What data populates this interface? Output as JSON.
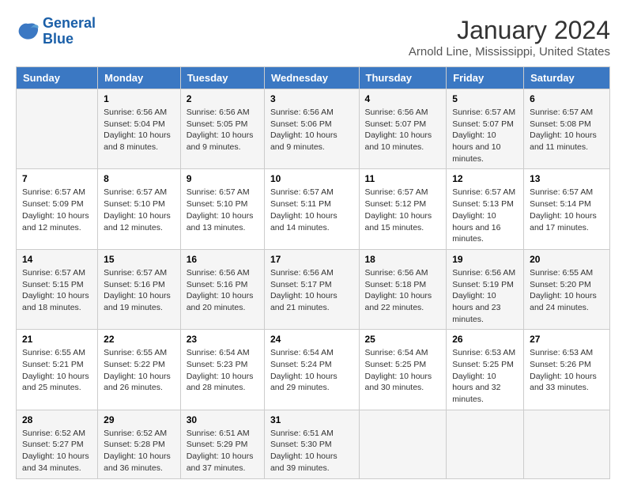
{
  "logo": {
    "line1": "General",
    "line2": "Blue"
  },
  "title": "January 2024",
  "location": "Arnold Line, Mississippi, United States",
  "header_days": [
    "Sunday",
    "Monday",
    "Tuesday",
    "Wednesday",
    "Thursday",
    "Friday",
    "Saturday"
  ],
  "weeks": [
    [
      {
        "day": "",
        "sunrise": "",
        "sunset": "",
        "daylight": ""
      },
      {
        "day": "1",
        "sunrise": "Sunrise: 6:56 AM",
        "sunset": "Sunset: 5:04 PM",
        "daylight": "Daylight: 10 hours and 8 minutes."
      },
      {
        "day": "2",
        "sunrise": "Sunrise: 6:56 AM",
        "sunset": "Sunset: 5:05 PM",
        "daylight": "Daylight: 10 hours and 9 minutes."
      },
      {
        "day": "3",
        "sunrise": "Sunrise: 6:56 AM",
        "sunset": "Sunset: 5:06 PM",
        "daylight": "Daylight: 10 hours and 9 minutes."
      },
      {
        "day": "4",
        "sunrise": "Sunrise: 6:56 AM",
        "sunset": "Sunset: 5:07 PM",
        "daylight": "Daylight: 10 hours and 10 minutes."
      },
      {
        "day": "5",
        "sunrise": "Sunrise: 6:57 AM",
        "sunset": "Sunset: 5:07 PM",
        "daylight": "Daylight: 10 hours and 10 minutes."
      },
      {
        "day": "6",
        "sunrise": "Sunrise: 6:57 AM",
        "sunset": "Sunset: 5:08 PM",
        "daylight": "Daylight: 10 hours and 11 minutes."
      }
    ],
    [
      {
        "day": "7",
        "sunrise": "Sunrise: 6:57 AM",
        "sunset": "Sunset: 5:09 PM",
        "daylight": "Daylight: 10 hours and 12 minutes."
      },
      {
        "day": "8",
        "sunrise": "Sunrise: 6:57 AM",
        "sunset": "Sunset: 5:10 PM",
        "daylight": "Daylight: 10 hours and 12 minutes."
      },
      {
        "day": "9",
        "sunrise": "Sunrise: 6:57 AM",
        "sunset": "Sunset: 5:10 PM",
        "daylight": "Daylight: 10 hours and 13 minutes."
      },
      {
        "day": "10",
        "sunrise": "Sunrise: 6:57 AM",
        "sunset": "Sunset: 5:11 PM",
        "daylight": "Daylight: 10 hours and 14 minutes."
      },
      {
        "day": "11",
        "sunrise": "Sunrise: 6:57 AM",
        "sunset": "Sunset: 5:12 PM",
        "daylight": "Daylight: 10 hours and 15 minutes."
      },
      {
        "day": "12",
        "sunrise": "Sunrise: 6:57 AM",
        "sunset": "Sunset: 5:13 PM",
        "daylight": "Daylight: 10 hours and 16 minutes."
      },
      {
        "day": "13",
        "sunrise": "Sunrise: 6:57 AM",
        "sunset": "Sunset: 5:14 PM",
        "daylight": "Daylight: 10 hours and 17 minutes."
      }
    ],
    [
      {
        "day": "14",
        "sunrise": "Sunrise: 6:57 AM",
        "sunset": "Sunset: 5:15 PM",
        "daylight": "Daylight: 10 hours and 18 minutes."
      },
      {
        "day": "15",
        "sunrise": "Sunrise: 6:57 AM",
        "sunset": "Sunset: 5:16 PM",
        "daylight": "Daylight: 10 hours and 19 minutes."
      },
      {
        "day": "16",
        "sunrise": "Sunrise: 6:56 AM",
        "sunset": "Sunset: 5:16 PM",
        "daylight": "Daylight: 10 hours and 20 minutes."
      },
      {
        "day": "17",
        "sunrise": "Sunrise: 6:56 AM",
        "sunset": "Sunset: 5:17 PM",
        "daylight": "Daylight: 10 hours and 21 minutes."
      },
      {
        "day": "18",
        "sunrise": "Sunrise: 6:56 AM",
        "sunset": "Sunset: 5:18 PM",
        "daylight": "Daylight: 10 hours and 22 minutes."
      },
      {
        "day": "19",
        "sunrise": "Sunrise: 6:56 AM",
        "sunset": "Sunset: 5:19 PM",
        "daylight": "Daylight: 10 hours and 23 minutes."
      },
      {
        "day": "20",
        "sunrise": "Sunrise: 6:55 AM",
        "sunset": "Sunset: 5:20 PM",
        "daylight": "Daylight: 10 hours and 24 minutes."
      }
    ],
    [
      {
        "day": "21",
        "sunrise": "Sunrise: 6:55 AM",
        "sunset": "Sunset: 5:21 PM",
        "daylight": "Daylight: 10 hours and 25 minutes."
      },
      {
        "day": "22",
        "sunrise": "Sunrise: 6:55 AM",
        "sunset": "Sunset: 5:22 PM",
        "daylight": "Daylight: 10 hours and 26 minutes."
      },
      {
        "day": "23",
        "sunrise": "Sunrise: 6:54 AM",
        "sunset": "Sunset: 5:23 PM",
        "daylight": "Daylight: 10 hours and 28 minutes."
      },
      {
        "day": "24",
        "sunrise": "Sunrise: 6:54 AM",
        "sunset": "Sunset: 5:24 PM",
        "daylight": "Daylight: 10 hours and 29 minutes."
      },
      {
        "day": "25",
        "sunrise": "Sunrise: 6:54 AM",
        "sunset": "Sunset: 5:25 PM",
        "daylight": "Daylight: 10 hours and 30 minutes."
      },
      {
        "day": "26",
        "sunrise": "Sunrise: 6:53 AM",
        "sunset": "Sunset: 5:25 PM",
        "daylight": "Daylight: 10 hours and 32 minutes."
      },
      {
        "day": "27",
        "sunrise": "Sunrise: 6:53 AM",
        "sunset": "Sunset: 5:26 PM",
        "daylight": "Daylight: 10 hours and 33 minutes."
      }
    ],
    [
      {
        "day": "28",
        "sunrise": "Sunrise: 6:52 AM",
        "sunset": "Sunset: 5:27 PM",
        "daylight": "Daylight: 10 hours and 34 minutes."
      },
      {
        "day": "29",
        "sunrise": "Sunrise: 6:52 AM",
        "sunset": "Sunset: 5:28 PM",
        "daylight": "Daylight: 10 hours and 36 minutes."
      },
      {
        "day": "30",
        "sunrise": "Sunrise: 6:51 AM",
        "sunset": "Sunset: 5:29 PM",
        "daylight": "Daylight: 10 hours and 37 minutes."
      },
      {
        "day": "31",
        "sunrise": "Sunrise: 6:51 AM",
        "sunset": "Sunset: 5:30 PM",
        "daylight": "Daylight: 10 hours and 39 minutes."
      },
      {
        "day": "",
        "sunrise": "",
        "sunset": "",
        "daylight": ""
      },
      {
        "day": "",
        "sunrise": "",
        "sunset": "",
        "daylight": ""
      },
      {
        "day": "",
        "sunrise": "",
        "sunset": "",
        "daylight": ""
      }
    ]
  ]
}
